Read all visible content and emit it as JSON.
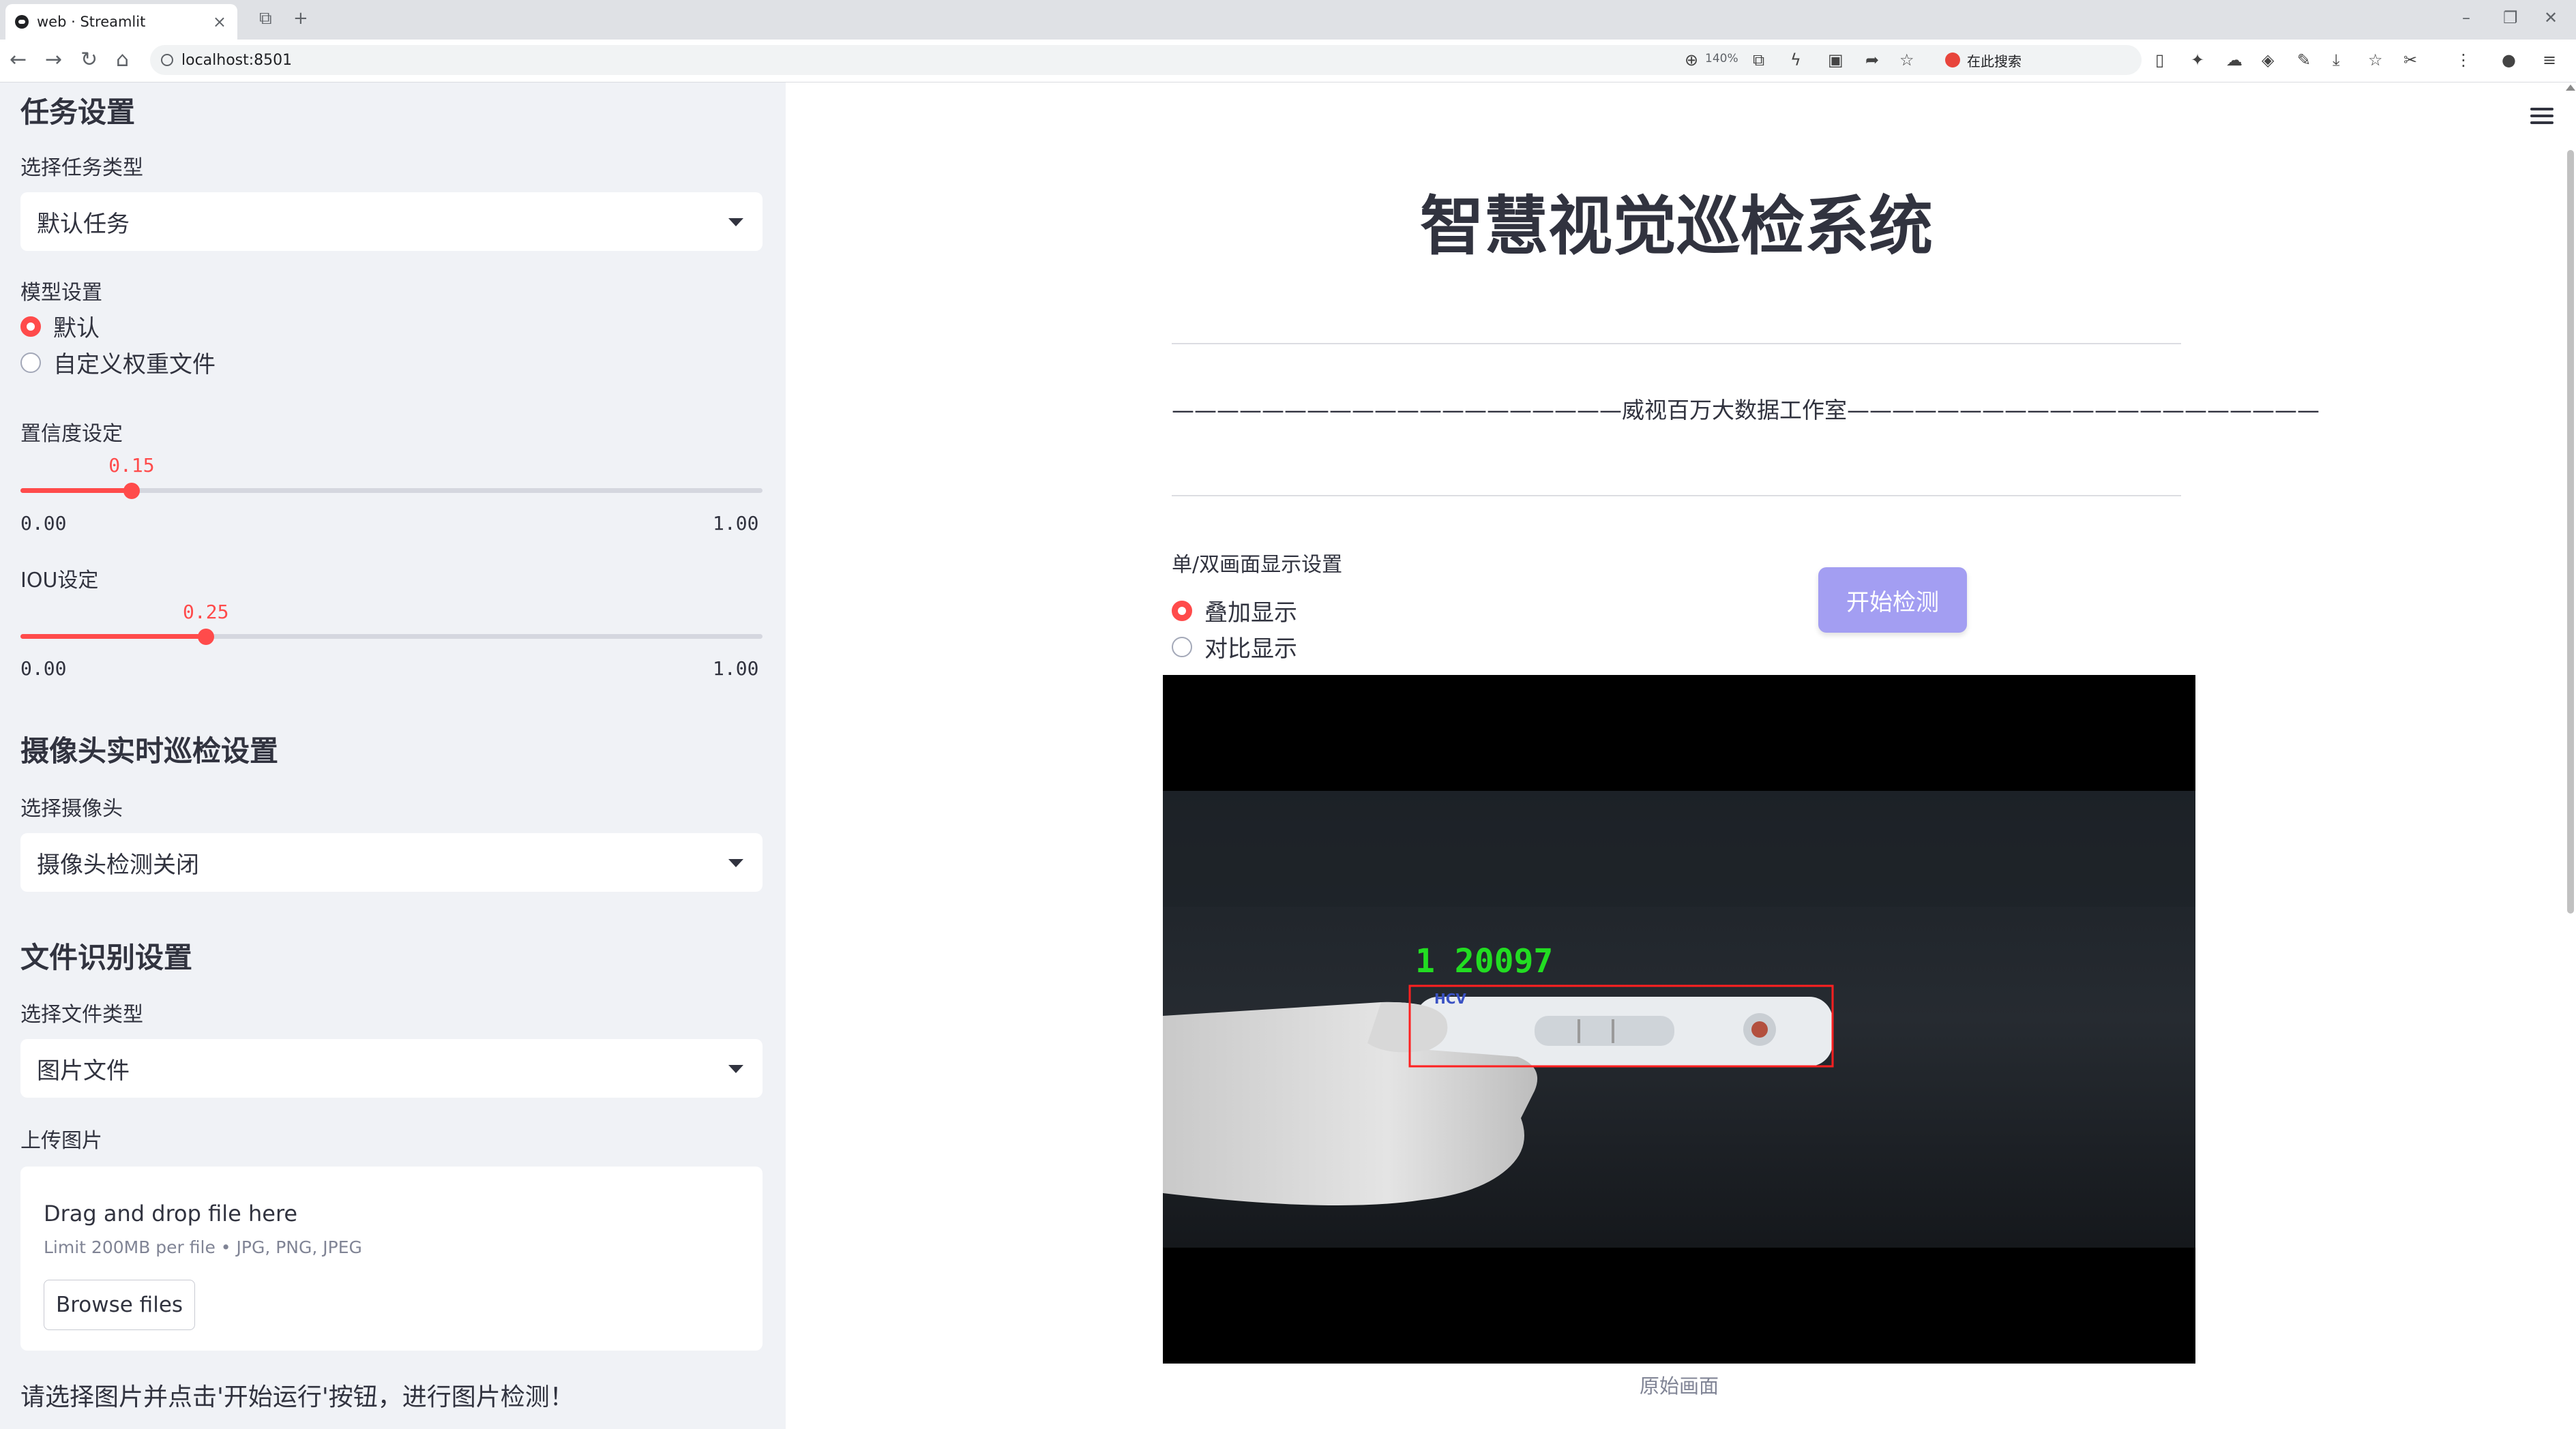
{
  "browser": {
    "tab_title": "web · Streamlit",
    "url": "localhost:8501",
    "zoom": "140%",
    "search_placeholder": "在此搜索"
  },
  "sidebar": {
    "task_section_title": "任务设置",
    "task_type_label": "选择任务类型",
    "task_type_value": "默认任务",
    "model_label": "模型设置",
    "model_options": [
      "默认",
      "自定义权重文件"
    ],
    "model_selected": 0,
    "confidence": {
      "label": "置信度设定",
      "value": 0.15,
      "value_text": "0.15",
      "min": "0.00",
      "max": "1.00"
    },
    "iou": {
      "label": "IOU设定",
      "value": 0.25,
      "value_text": "0.25",
      "min": "0.00",
      "max": "1.00"
    },
    "camera_section_title": "摄像头实时巡检设置",
    "camera_label": "选择摄像头",
    "camera_value": "摄像头检测关闭",
    "file_section_title": "文件识别设置",
    "file_type_label": "选择文件类型",
    "file_type_value": "图片文件",
    "upload_label": "上传图片",
    "upload_drop_text": "Drag and drop file here",
    "upload_limit_text": "Limit 200MB per file • JPG, PNG, JPEG",
    "browse_label": "Browse files",
    "hint": "请选择图片并点击'开始运行'按钮，进行图片检测！"
  },
  "main": {
    "title": "智慧视觉巡检系统",
    "studio_line": "————————————————————威视百万大数据工作室—————————————————————",
    "view_label": "单/双画面显示设置",
    "view_options": [
      "叠加显示",
      "对比显示"
    ],
    "view_selected": 0,
    "start_button": "开始检测",
    "detection_label": "1  20097",
    "strip_text": "HCV",
    "image_caption": "原始画面"
  },
  "colors": {
    "accent": "#ff4b4b",
    "sidebar_bg": "#f0f2f6",
    "button_primary": "#a39ef2",
    "detection_box": "#ff2020",
    "detection_text": "#22dd22"
  }
}
